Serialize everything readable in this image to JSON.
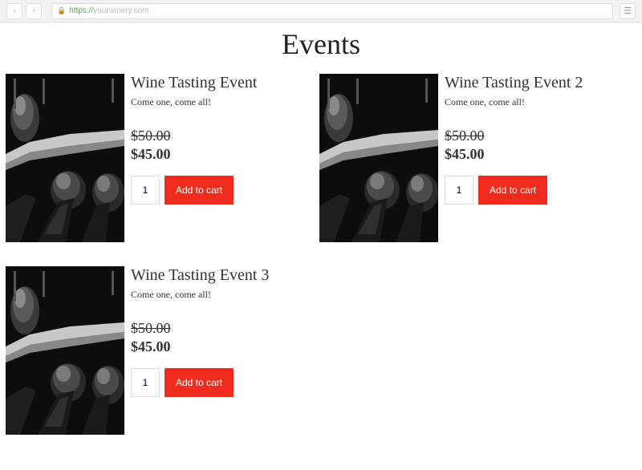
{
  "browser": {
    "url_scheme": "https://",
    "url_rest": "yourwinery.com"
  },
  "page": {
    "title": "Events"
  },
  "products": [
    {
      "title": "Wine Tasting Event",
      "desc": "Come one, come all!",
      "price_old": "$50.00",
      "price_new": "$45.00",
      "qty": "1",
      "cta": "Add to cart"
    },
    {
      "title": "Wine Tasting Event 2",
      "desc": "Come one, come all!",
      "price_old": "$50.00",
      "price_new": "$45.00",
      "qty": "1",
      "cta": "Add to cart"
    },
    {
      "title": "Wine Tasting Event 3",
      "desc": "Come one, come all!",
      "price_old": "$50.00",
      "price_new": "$45.00",
      "qty": "1",
      "cta": "Add to cart"
    }
  ]
}
